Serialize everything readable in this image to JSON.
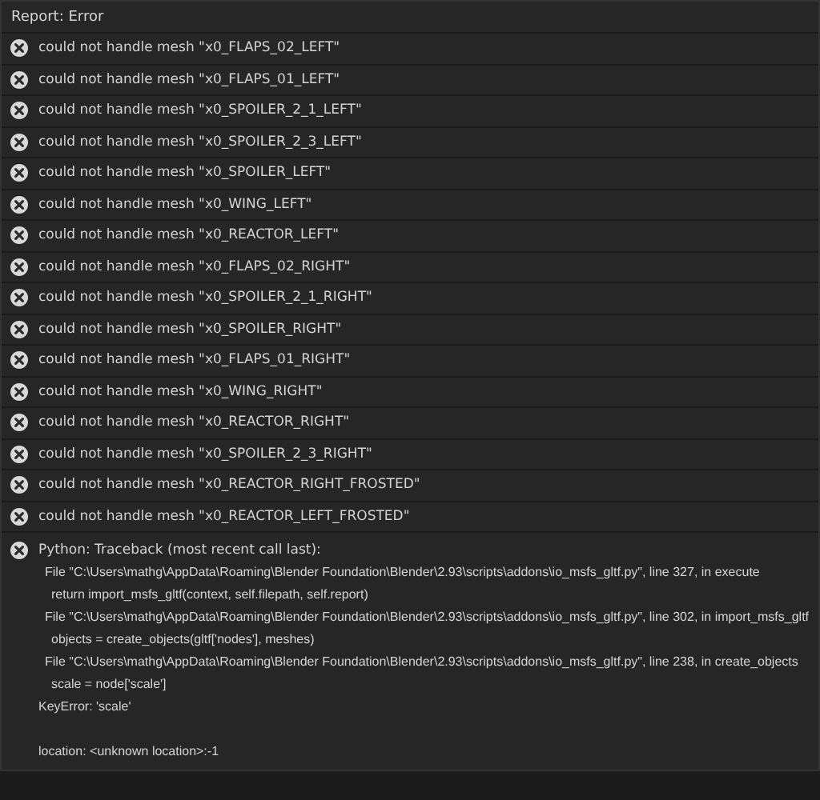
{
  "report": {
    "title": "Report: Error",
    "messages": [
      {
        "text": "could not handle mesh \"x0_FLAPS_02_LEFT\""
      },
      {
        "text": "could not handle mesh \"x0_FLAPS_01_LEFT\""
      },
      {
        "text": "could not handle mesh \"x0_SPOILER_2_1_LEFT\""
      },
      {
        "text": "could not handle mesh \"x0_SPOILER_2_3_LEFT\""
      },
      {
        "text": "could not handle mesh \"x0_SPOILER_LEFT\""
      },
      {
        "text": "could not handle mesh \"x0_WING_LEFT\""
      },
      {
        "text": "could not handle mesh \"x0_REACTOR_LEFT\""
      },
      {
        "text": "could not handle mesh \"x0_FLAPS_02_RIGHT\""
      },
      {
        "text": "could not handle mesh \"x0_SPOILER_2_1_RIGHT\""
      },
      {
        "text": "could not handle mesh \"x0_SPOILER_RIGHT\""
      },
      {
        "text": "could not handle mesh \"x0_FLAPS_01_RIGHT\""
      },
      {
        "text": "could not handle mesh \"x0_WING_RIGHT\""
      },
      {
        "text": "could not handle mesh \"x0_REACTOR_RIGHT\""
      },
      {
        "text": "could not handle mesh \"x0_SPOILER_2_3_RIGHT\""
      },
      {
        "text": "could not handle mesh \"x0_REACTOR_RIGHT_FROSTED\""
      },
      {
        "text": "could not handle mesh \"x0_REACTOR_LEFT_FROSTED\""
      }
    ],
    "traceback": {
      "header": "Python: Traceback (most recent call last):",
      "lines": [
        {
          "kind": "file",
          "text": "File \"C:\\Users\\mathg\\AppData\\Roaming\\Blender Foundation\\Blender\\2.93\\scripts\\addons\\io_msfs_gltf.py\", line 327, in execute"
        },
        {
          "kind": "code",
          "text": "return import_msfs_gltf(context, self.filepath, self.report)"
        },
        {
          "kind": "file",
          "text": "File \"C:\\Users\\mathg\\AppData\\Roaming\\Blender Foundation\\Blender\\2.93\\scripts\\addons\\io_msfs_gltf.py\", line 302, in import_msfs_gltf"
        },
        {
          "kind": "code",
          "text": "objects = create_objects(gltf['nodes'], meshes)"
        },
        {
          "kind": "file",
          "text": "File \"C:\\Users\\mathg\\AppData\\Roaming\\Blender Foundation\\Blender\\2.93\\scripts\\addons\\io_msfs_gltf.py\", line 238, in create_objects"
        },
        {
          "kind": "code",
          "text": "scale = node['scale']"
        },
        {
          "kind": "error",
          "text": "KeyError: 'scale'"
        },
        {
          "kind": "blank"
        },
        {
          "kind": "error",
          "text": "location: <unknown location>:-1"
        }
      ]
    }
  }
}
